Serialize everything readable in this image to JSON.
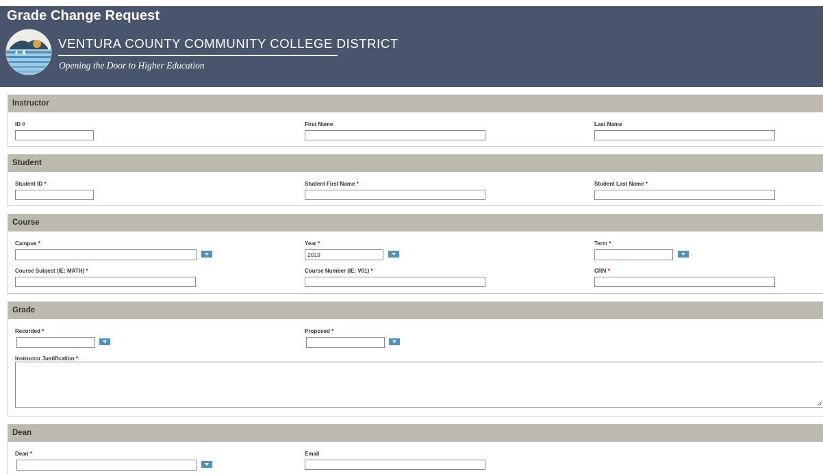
{
  "page": {
    "title": "Grade Change Request",
    "district_name": "VENTURA COUNTY COMMUNITY COLLEGE DISTRICT",
    "tagline": "Opening the Door to Higher Education"
  },
  "required_marker": "*",
  "instructor": {
    "heading": "Instructor",
    "id_label": "ID #",
    "first_name_label": "First Name",
    "last_name_label": "Last Name"
  },
  "student": {
    "heading": "Student",
    "id_label": "Student ID",
    "first_name_label": "Student First Name",
    "last_name_label": "Student Last Name"
  },
  "course": {
    "heading": "Course",
    "campus_label": "Campus",
    "campus_value": "",
    "year_label": "Year",
    "year_value": "2019",
    "term_label": "Term",
    "term_value": "",
    "subject_label": "Course Subject (IE: MATH)",
    "number_label": "Course Number (IE: V01)",
    "crn_label": "CRN"
  },
  "grade": {
    "heading": "Grade",
    "recorded_label": "Recorded",
    "recorded_value": "",
    "proposed_label": "Proposed",
    "proposed_value": "",
    "justification_label": "Instructor Justification"
  },
  "dean": {
    "heading": "Dean",
    "dean_label": "Dean",
    "dean_value": "",
    "email_label": "Email"
  },
  "colors": {
    "header_bg": "#48556d",
    "section_head_bg": "#bcbaae",
    "dropdown_button": "#4f93c3",
    "required": "#c00000"
  },
  "icons": [
    "district-seal-logo",
    "chevron-down-icon",
    "resize-grip-icon"
  ]
}
